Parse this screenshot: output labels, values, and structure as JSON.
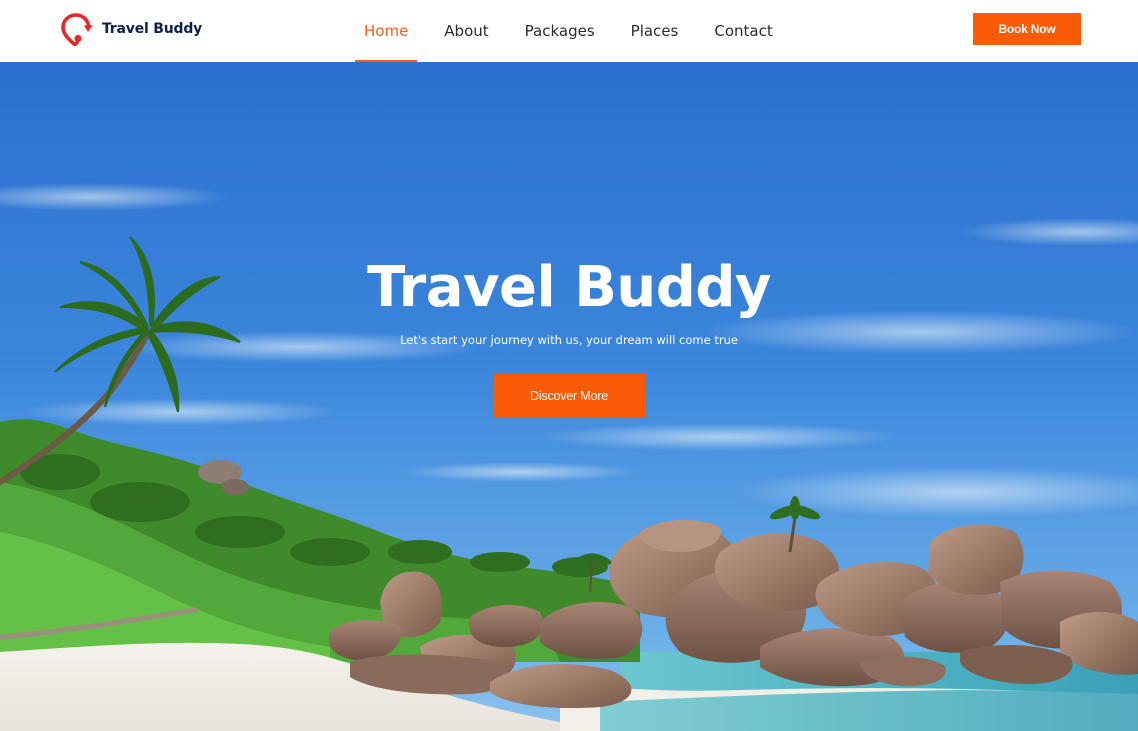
{
  "brand": {
    "name": "Travel Buddy",
    "icon": "location-pin-arrow-icon",
    "color": "#0d1f4e",
    "icon_color": "#e8272a"
  },
  "nav": {
    "items": [
      {
        "label": "Home",
        "active": true
      },
      {
        "label": "About",
        "active": false
      },
      {
        "label": "Packages",
        "active": false
      },
      {
        "label": "Places",
        "active": false
      },
      {
        "label": "Contact",
        "active": false
      }
    ],
    "book_label": "Book Now"
  },
  "hero": {
    "title": "Travel Buddy",
    "subtitle": "Let's start your journey with us, your dream will come true",
    "cta_label": "Discover More",
    "image": "tropical-beach-palm-rocks-image"
  },
  "colors": {
    "accent": "#fb5a07",
    "active_nav": "#f95c1a"
  }
}
